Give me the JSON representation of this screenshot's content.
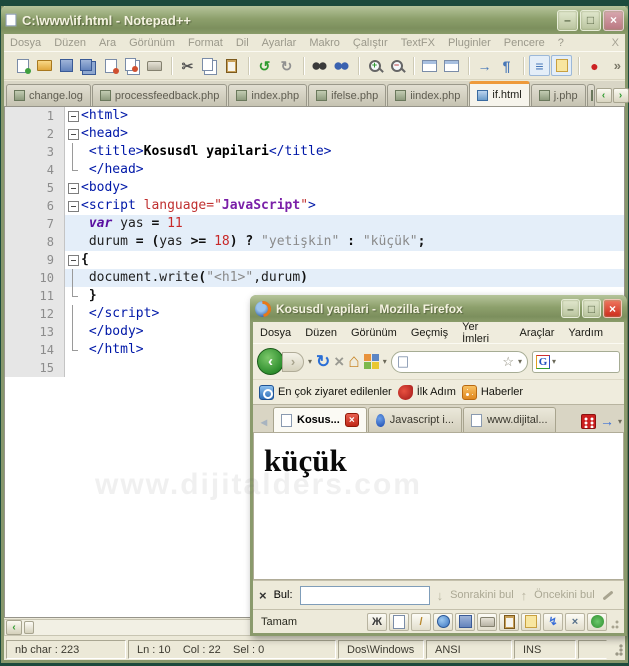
{
  "chrome": {
    "min": "–",
    "max": "□",
    "close": "×"
  },
  "watermark": "www.dijitalders.com",
  "notepadpp": {
    "title": "C:\\www\\if.html - Notepad++",
    "menu": [
      "Dosya",
      "Düzen",
      "Ara",
      "Görünüm",
      "Format",
      "Dil",
      "Ayarlar",
      "Makro",
      "Çalıştır",
      "TextFX",
      "Pluginler",
      "Pencere",
      "?"
    ],
    "menu_right": "X",
    "toolbar": [
      {
        "name": "new-file",
        "k": "pg",
        "dot": "#3FA03F"
      },
      {
        "name": "open",
        "k": "fold"
      },
      {
        "name": "save",
        "k": "dsk"
      },
      {
        "name": "save-all",
        "k": "dsk2"
      },
      {
        "name": "close",
        "k": "pg",
        "dot": "#D05030"
      },
      {
        "name": "close-all",
        "k": "pg2",
        "dot": "#D05030"
      },
      {
        "name": "print",
        "k": "prn"
      },
      {
        "sep": true
      },
      {
        "name": "cut",
        "g": "✂",
        "c": "#555555"
      },
      {
        "name": "copy",
        "k": "pg2"
      },
      {
        "name": "paste",
        "k": "clip"
      },
      {
        "sep": true
      },
      {
        "name": "undo",
        "g": "↺",
        "c": "#2F9B2F"
      },
      {
        "name": "redo",
        "g": "↻",
        "c": "#909090"
      },
      {
        "sep": true
      },
      {
        "name": "find",
        "k": "bino"
      },
      {
        "name": "replace",
        "k": "bino2"
      },
      {
        "sep": true
      },
      {
        "name": "zoom-in",
        "k": "mag",
        "g": "+",
        "c": "#2F9B2F"
      },
      {
        "name": "zoom-out",
        "k": "mag",
        "g": "−",
        "c": "#C04040"
      },
      {
        "sep": true
      },
      {
        "name": "sync-vertical",
        "k": "win"
      },
      {
        "name": "sync-horizontal",
        "k": "win"
      },
      {
        "sep": true
      },
      {
        "name": "word-wrap",
        "g": "→",
        "c": "#4878B8"
      },
      {
        "name": "show-all-chars",
        "g": "¶",
        "c": "#4878B8"
      },
      {
        "sep": true
      },
      {
        "name": "doc-switcher",
        "g": "≡",
        "c": "#4878B8",
        "pressed": true
      },
      {
        "name": "doc-map",
        "k": "note",
        "pressed": true
      },
      {
        "sep": true
      },
      {
        "name": "macro-record",
        "g": "●",
        "c": "#CC2222"
      }
    ],
    "toolbar_overflow": "»",
    "tabs": [
      {
        "label": "change.log"
      },
      {
        "label": "processfeedback.php"
      },
      {
        "label": "index.php"
      },
      {
        "label": "ifelse.php"
      },
      {
        "label": "iindex.php"
      },
      {
        "label": "if.html",
        "active": true
      },
      {
        "label": "j.php"
      },
      {
        "label": "i",
        "partial": true
      }
    ],
    "tab_scroll": {
      "left": "‹",
      "right": "›"
    },
    "editor": {
      "lines": [
        {
          "n": "1",
          "fold": "box",
          "tokens": [
            {
              "t": "<html>",
              "c": "tag"
            }
          ]
        },
        {
          "n": "2",
          "fold": "box",
          "tokens": [
            {
              "t": "<head>",
              "c": "tag"
            }
          ]
        },
        {
          "n": "3",
          "fold": "line",
          "tokens": [
            {
              "t": " ",
              "c": "txt"
            },
            {
              "t": "<title>",
              "c": "tag"
            },
            {
              "t": "Kosusdl yapilari",
              "c": "b"
            },
            {
              "t": "</title>",
              "c": "tag"
            }
          ]
        },
        {
          "n": "4",
          "fold": "end",
          "tokens": [
            {
              "t": " ",
              "c": "txt"
            },
            {
              "t": "</head>",
              "c": "tag"
            }
          ]
        },
        {
          "n": "5",
          "fold": "box",
          "tokens": [
            {
              "t": "<body>",
              "c": "tag"
            }
          ]
        },
        {
          "n": "6",
          "fold": "box",
          "tokens": [
            {
              "t": "<script ",
              "c": "tag"
            },
            {
              "t": "language=",
              "c": "attr"
            },
            {
              "t": "\"",
              "c": "attr"
            },
            {
              "t": "JavaScript",
              "c": "val"
            },
            {
              "t": "\"",
              "c": "attr"
            },
            {
              "t": ">",
              "c": "tag"
            }
          ]
        },
        {
          "n": "7",
          "fold": "none",
          "hl": true,
          "tokens": [
            {
              "t": " ",
              "c": "txt"
            },
            {
              "t": "var",
              "c": "kw"
            },
            {
              "t": " yas ",
              "c": "txt"
            },
            {
              "t": "=",
              "c": "op"
            },
            {
              "t": " ",
              "c": "txt"
            },
            {
              "t": "11",
              "c": "num"
            }
          ]
        },
        {
          "n": "8",
          "fold": "none",
          "hl": true,
          "tokens": [
            {
              "t": " durum ",
              "c": "txt"
            },
            {
              "t": "= (",
              "c": "op"
            },
            {
              "t": "yas ",
              "c": "txt"
            },
            {
              "t": ">= ",
              "c": "op"
            },
            {
              "t": "18",
              "c": "num"
            },
            {
              "t": ")",
              "c": "op"
            },
            {
              "t": " ",
              "c": "txt"
            },
            {
              "t": "?",
              "c": "op"
            },
            {
              "t": " ",
              "c": "txt"
            },
            {
              "t": "\"yetişkin\"",
              "c": "str"
            },
            {
              "t": " ",
              "c": "txt"
            },
            {
              "t": ":",
              "c": "op"
            },
            {
              "t": " ",
              "c": "txt"
            },
            {
              "t": "\"küçük\"",
              "c": "str"
            },
            {
              "t": ";",
              "c": "op"
            }
          ]
        },
        {
          "n": "9",
          "fold": "box",
          "tokens": [
            {
              "t": "{",
              "c": "op"
            }
          ]
        },
        {
          "n": "10",
          "fold": "line",
          "hl": true,
          "tokens": [
            {
              "t": " document.write",
              "c": "txt"
            },
            {
              "t": "(",
              "c": "op"
            },
            {
              "t": "\"<h1>\"",
              "c": "str"
            },
            {
              "t": ",durum",
              "c": "txt"
            },
            {
              "t": ")",
              "c": "op"
            }
          ]
        },
        {
          "n": "11",
          "fold": "end",
          "tokens": [
            {
              "t": " ",
              "c": "txt"
            },
            {
              "t": "}",
              "c": "op"
            }
          ]
        },
        {
          "n": "12",
          "fold": "line",
          "tokens": [
            {
              "t": " ",
              "c": "txt"
            },
            {
              "t": "</script>",
              "c": "tag"
            }
          ]
        },
        {
          "n": "13",
          "fold": "line",
          "tokens": [
            {
              "t": " ",
              "c": "txt"
            },
            {
              "t": "</body>",
              "c": "tag"
            }
          ]
        },
        {
          "n": "14",
          "fold": "end",
          "tokens": [
            {
              "t": " ",
              "c": "txt"
            },
            {
              "t": "</html>",
              "c": "tag"
            }
          ]
        },
        {
          "n": "15",
          "fold": "none",
          "tokens": []
        }
      ]
    },
    "hscroll_left": "‹",
    "statusbar": {
      "chars": "nb char : 223",
      "pos": "Ln : 10    Col : 22    Sel : 0",
      "eol": "Dos\\Windows",
      "enc": "ANSI",
      "mode": "INS"
    }
  },
  "firefox": {
    "title": "Kosusdl yapilari - Mozilla Firefox",
    "menu": [
      "Dosya",
      "Düzen",
      "Görünüm",
      "Geçmiş",
      "Yer İmleri",
      "Araçlar",
      "Yardım"
    ],
    "nav": {
      "back": "‹",
      "fwd": "›",
      "caret": "▾",
      "reload": "↻",
      "stop": "×",
      "home": "⌂",
      "google": "G"
    },
    "grid_colors": [
      "#E8923C",
      "#5C86C5",
      "#7CB84C",
      "#E8C832"
    ],
    "bookmarks": [
      {
        "label": "En çok ziyaret edilenler",
        "icon": "most-visited"
      },
      {
        "label": "İlk Adım",
        "icon": "firefox-red"
      },
      {
        "label": "Haberler",
        "icon": "rss"
      }
    ],
    "tab_scroll_left": "◂",
    "tabs": [
      {
        "label": "Kosus...",
        "active": true,
        "icon": "page",
        "close": "×"
      },
      {
        "label": "Javascript i...",
        "icon": "blue"
      },
      {
        "label": "www.dijital...",
        "icon": "page"
      }
    ],
    "tab_scroll_right": "→",
    "tab_caret": "▾",
    "content_heading": "küçük",
    "findbar": {
      "close": "×",
      "label": "Bul:",
      "next_arrow": "↓",
      "next": "Sonrakini bul",
      "prev_arrow": "↑",
      "prev": "Öncekini bul"
    },
    "statusbar": {
      "status": "Tamam",
      "icons": [
        {
          "name": "console-bug",
          "g": "Ж",
          "c": "#3A3A3A"
        },
        {
          "name": "new-page",
          "k": "pg"
        },
        {
          "name": "edit-pencil",
          "g": "/",
          "c": "#B8872B"
        },
        {
          "name": "view-globe",
          "k": "globe"
        },
        {
          "name": "save",
          "k": "dsk"
        },
        {
          "name": "print",
          "k": "prn"
        },
        {
          "name": "clipboard",
          "k": "clip"
        },
        {
          "name": "note",
          "k": "note"
        },
        {
          "name": "lightning",
          "g": "↯",
          "c": "#3A6FD8"
        },
        {
          "name": "tools",
          "g": "×",
          "c": "#56708A"
        },
        {
          "name": "info",
          "k": "info"
        }
      ]
    }
  }
}
